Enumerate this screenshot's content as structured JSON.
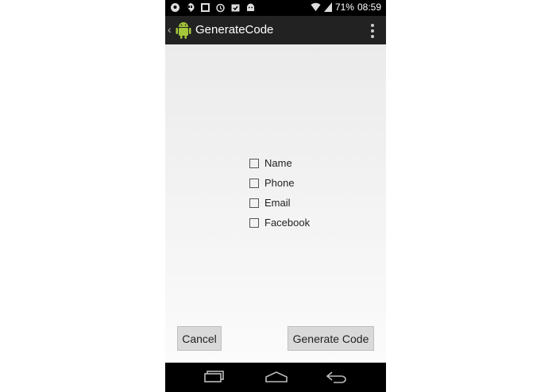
{
  "status": {
    "battery": "71%",
    "time": "08:59"
  },
  "app": {
    "title": "GenerateCode"
  },
  "checkboxes": [
    {
      "label": "Name",
      "checked": false
    },
    {
      "label": "Phone",
      "checked": false
    },
    {
      "label": "Email",
      "checked": false
    },
    {
      "label": "Facebook",
      "checked": false
    }
  ],
  "buttons": {
    "cancel": "Cancel",
    "generate": "Generate Code"
  },
  "icons": {
    "status_left": [
      "notification-icon",
      "hangouts-icon",
      "square-icon",
      "alarm-icon",
      "calendar-icon",
      "android-debug-icon"
    ],
    "status_right": [
      "wifi-icon",
      "signal-icon"
    ],
    "nav": [
      "recent-apps-icon",
      "home-icon",
      "back-icon"
    ]
  },
  "colors": {
    "accent_green": "#a4c639",
    "actionbar": "#222222",
    "statusbar": "#000000"
  }
}
